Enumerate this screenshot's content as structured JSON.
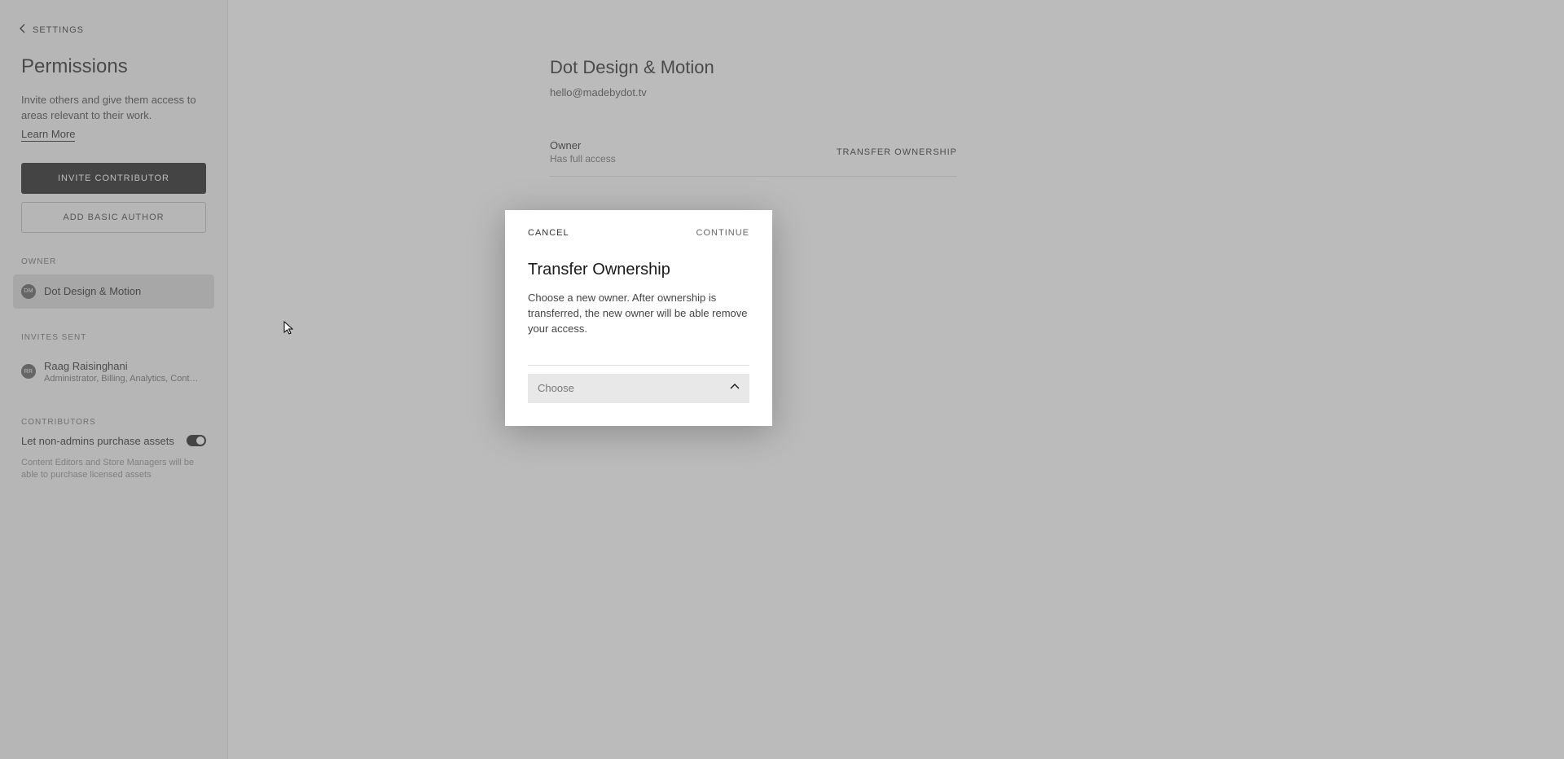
{
  "sidebar": {
    "back_label": "SETTINGS",
    "title": "Permissions",
    "description": "Invite others and give them access to areas relevant to their work.",
    "learn_more": "Learn More",
    "invite_btn": "INVITE CONTRIBUTOR",
    "add_author_btn": "ADD BASIC AUTHOR",
    "owner_label": "OWNER",
    "owner": {
      "initials": "DM",
      "name": "Dot Design & Motion"
    },
    "invites_label": "INVITES SENT",
    "invites": [
      {
        "initials": "RR",
        "name": "Raag Raisinghani",
        "roles": "Administrator, Billing, Analytics, Content ..."
      }
    ],
    "contributors_label": "CONTRIBUTORS",
    "toggle_label": "Let non-admins purchase assets",
    "toggle_on": true,
    "toggle_help": "Content Editors and Store Managers will be able to purchase licensed assets"
  },
  "main": {
    "org_name": "Dot Design & Motion",
    "org_email": "hello@madebydot.tv",
    "role": "Owner",
    "role_sub": "Has full access",
    "transfer_link": "TRANSFER OWNERSHIP"
  },
  "modal": {
    "cancel": "CANCEL",
    "continue": "CONTINUE",
    "title": "Transfer Ownership",
    "description": "Choose a new owner. After ownership is transferred, the new owner will be able remove your access.",
    "select_placeholder": "Choose"
  }
}
